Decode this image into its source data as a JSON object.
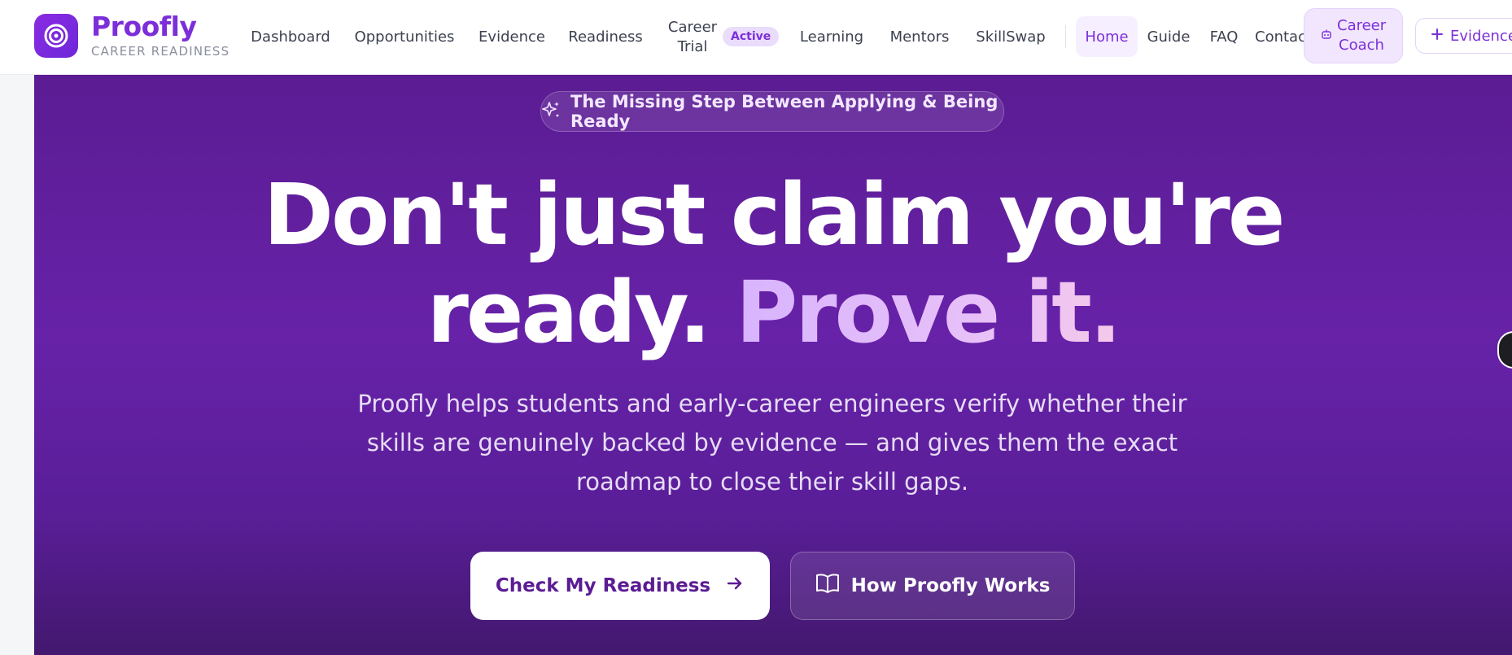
{
  "brand": {
    "name": "Proofly",
    "subtitle": "CAREER READINESS",
    "logo_icon": "target-icon"
  },
  "nav": {
    "links": [
      "Dashboard",
      "Opportunities",
      "Evidence",
      "Readiness",
      "Career Trial",
      "Learning",
      "Mentors",
      "SkillSwap"
    ],
    "career_trial_badge": "Active",
    "secondary_links": [
      "Home",
      "Guide",
      "FAQ",
      "Contac"
    ],
    "active_link": "Home",
    "coach_button": "Career Coach",
    "coach_icon": "robot-icon",
    "evidence_button": "Evidence",
    "evidence_icon": "plus-icon"
  },
  "hero": {
    "tag": "The Missing Step Between Applying & Being Ready",
    "tag_icon": "sparkles-icon",
    "headline_line1": "Don't just claim you're",
    "headline_line2_plain": "ready. ",
    "headline_line2_accent": "Prove it.",
    "description": "Proofly helps students and early-career engineers verify whether their skills are genuinely backed by evidence — and gives them the exact roadmap to close their skill gaps.",
    "primary_cta": "Check My Readiness",
    "primary_cta_icon": "arrow-right-icon",
    "secondary_cta": "How Proofly Works",
    "secondary_cta_icon": "book-open-icon"
  },
  "colors": {
    "brand_purple": "#7c2fd9",
    "hero_top": "#5b1c93",
    "hero_bottom": "#43186e",
    "accent_gradient_start": "#d8b4fe",
    "accent_gradient_end": "#f5c9ea"
  }
}
